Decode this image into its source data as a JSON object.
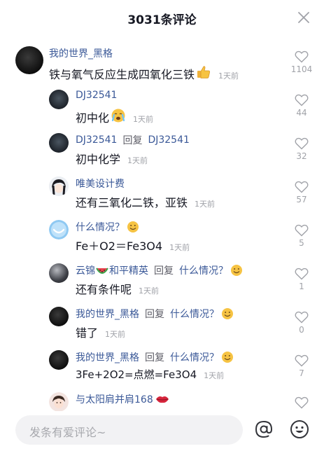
{
  "header": {
    "title": "3031条评论",
    "close_icon": "close-icon"
  },
  "comments": [
    {
      "user": "我的世界_黑格",
      "text": "铁与氧气反应生成四氧化三铁",
      "emoji": "thumbs-up",
      "time": "1天前",
      "likes": "1104"
    },
    {
      "user": "DJ32541",
      "text": "初中化",
      "emoji": "crying-face",
      "time": "1天前",
      "likes": "44"
    },
    {
      "user": "DJ32541",
      "reply_word": "回复",
      "reply_to": "DJ32541",
      "text": "初中化学",
      "time": "1天前",
      "likes": "32"
    },
    {
      "user": "唯美设计费",
      "text": "还有三氧化二铁，亚铁",
      "time": "1天前",
      "likes": "57"
    },
    {
      "user": "什么情况？",
      "user_emoji": "smiling-face",
      "text": "Fe＋O2＝Fe3O4",
      "time": "1天前",
      "likes": "5"
    },
    {
      "user": "云锦",
      "user_emoji_mid": "watermelon",
      "user_tail": "和平精英",
      "reply_word": "回复",
      "reply_to": "什么情况？",
      "reply_emoji": "smiling-face",
      "text": "还有条件呢",
      "time": "1天前",
      "likes": "1"
    },
    {
      "user": "我的世界_黑格",
      "reply_word": "回复",
      "reply_to": "什么情况？",
      "reply_emoji": "smiling-face",
      "text": "错了",
      "time": "1天前",
      "likes": "0"
    },
    {
      "user": "我的世界_黑格",
      "reply_word": "回复",
      "reply_to": "什么情况？",
      "reply_emoji": "smiling-face",
      "text": "3Fe+2O2=点燃=Fe3O4",
      "time": "1天前",
      "likes": "7"
    },
    {
      "user": "与太阳肩并肩168",
      "user_emoji": "lips"
    }
  ],
  "input": {
    "placeholder": "发条有爱评论~"
  },
  "icons": {
    "at": "at-icon",
    "emoji": "emoji-icon",
    "like": "heart-outline-icon"
  },
  "colors": {
    "username": "#3b5998",
    "text": "#161823",
    "meta": "#a0a2a8",
    "input_bg": "#f2f2f4"
  }
}
